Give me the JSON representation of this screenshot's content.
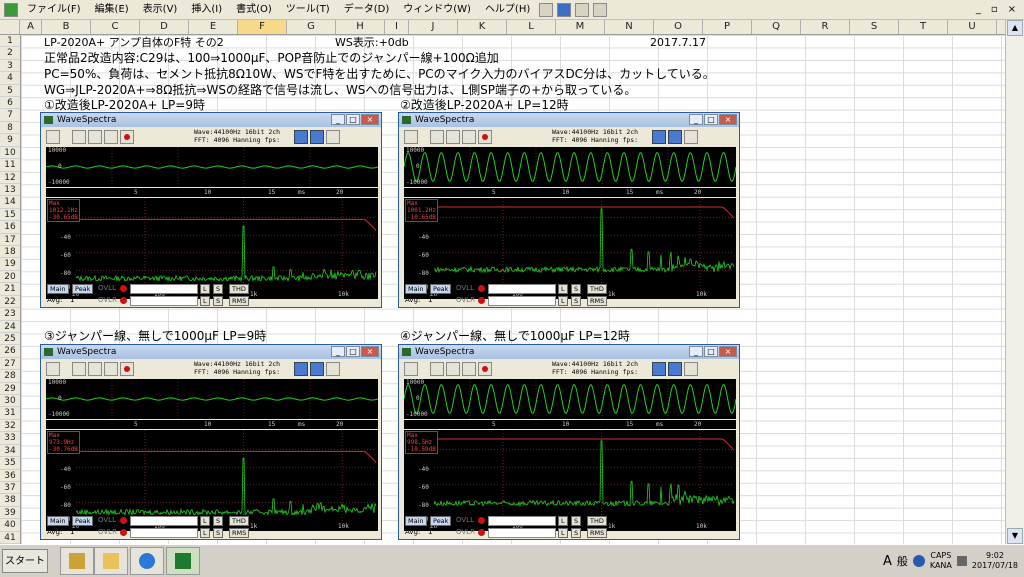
{
  "menubar": {
    "items": [
      "ファイル(F)",
      "編集(E)",
      "表示(V)",
      "挿入(I)",
      "書式(O)",
      "ツール(T)",
      "データ(D)",
      "ウィンドウ(W)",
      "ヘルプ(H)"
    ],
    "right_controls": [
      "_",
      "▫",
      "×"
    ]
  },
  "sheet": {
    "columns": [
      "A",
      "B",
      "C",
      "D",
      "E",
      "F",
      "G",
      "H",
      "I",
      "J",
      "K",
      "L",
      "M",
      "N",
      "O",
      "P",
      "Q",
      "R",
      "S",
      "T",
      "U",
      "V"
    ],
    "selected_column": "F",
    "rows": [
      "1",
      "2",
      "3",
      "4",
      "5",
      "6",
      "7",
      "8",
      "9",
      "10",
      "11",
      "12",
      "13",
      "14",
      "15",
      "16",
      "17",
      "18",
      "19",
      "20",
      "21",
      "22",
      "23",
      "24",
      "25",
      "26",
      "27",
      "28",
      "29",
      "30",
      "31",
      "32",
      "33",
      "34",
      "35",
      "36",
      "37",
      "38",
      "39",
      "40",
      "41"
    ],
    "cells": {
      "title": "LP-2020A+ アンプ自体のF特 その2",
      "ws_display": "WS表示:+0db",
      "date": "2017.7.17",
      "line2": "正常品2改造内容:C29は、100⇒1000μF、POP音防止でのジャンパー線+100Ω追加",
      "line3": "PC=50%、負荷は、セメント抵抗8Ω10W、WSでF特を出すために、PCのマイク入力のバイアスDC分は、カットしている。",
      "line4": "WG⇒JLP-2020A+⇒8Ω抵抗⇒WSの経路で信号は流し、WSへの信号出力は、L側SP端子の+から取っている。",
      "cap1": "①改造後LP-2020A+ LP=9時",
      "cap2": "②改造後LP-2020A+ LP=12時",
      "cap3": "③ジャンパー線、無しで1000μF LP=9時",
      "cap4": "④ジャンパー線、無しで1000μF LP=12時"
    }
  },
  "wavespectra": {
    "title": "WaveSpectra",
    "wave_info": "Wave:44100Hz 16bit 2ch",
    "fft_info": "FFT: 4096 Hanning  fps:",
    "scope_y": [
      "10000",
      "0",
      "-10000"
    ],
    "scope_x": [
      "5",
      "10",
      "15",
      "ms",
      "20"
    ],
    "spec_y": [
      "0dB",
      "-20",
      "-40",
      "-60",
      "-80",
      "-100"
    ],
    "spec_x": [
      "20",
      "100",
      "1k",
      "10k"
    ],
    "buttons": {
      "main": "Main",
      "peak": "Peak",
      "ovl": "OVL",
      "avg": "Avg:",
      "avg_val": "1",
      "l": "L",
      "s": "S",
      "thd": "THD",
      "rms": "RMS"
    },
    "windows": [
      {
        "max_label": "Max",
        "max_freq": "1012.1Hz",
        "max_db": "-30.65dB",
        "wave_amp": 0.06,
        "wave_cycles": 14,
        "peak_f": 1000,
        "peak_db": -30,
        "noise_db": -92,
        "curve_cut_hz": 17000
      },
      {
        "max_label": "Max",
        "max_freq": "1001.2Hz",
        "max_db": "-10.65dB",
        "wave_amp": 0.8,
        "wave_cycles": 20,
        "peak_f": 1000,
        "peak_db": -10,
        "noise_db": -82,
        "curve_cut_hz": 17000
      },
      {
        "max_label": "Max",
        "max_freq": "973.9Hz",
        "max_db": "-30.76dB",
        "wave_amp": 0.06,
        "wave_cycles": 14,
        "peak_f": 1000,
        "peak_db": -30,
        "noise_db": -94,
        "curve_cut_hz": 17000
      },
      {
        "max_label": "Max",
        "max_freq": "998.5Hz",
        "max_db": "-10.59dB",
        "wave_amp": 0.8,
        "wave_cycles": 20,
        "peak_f": 1000,
        "peak_db": -10,
        "noise_db": -84,
        "curve_cut_hz": 17000
      }
    ]
  },
  "taskbar": {
    "start": "スタート",
    "apps": [
      "toolbox-icon",
      "folder-icon",
      "ie-icon",
      "excel-icon"
    ],
    "tray": {
      "ime_a": "A",
      "ime_kan": "般",
      "caps": "CAPS",
      "kana": "KANA",
      "time": "9:02",
      "date": "2017/07/18"
    }
  }
}
